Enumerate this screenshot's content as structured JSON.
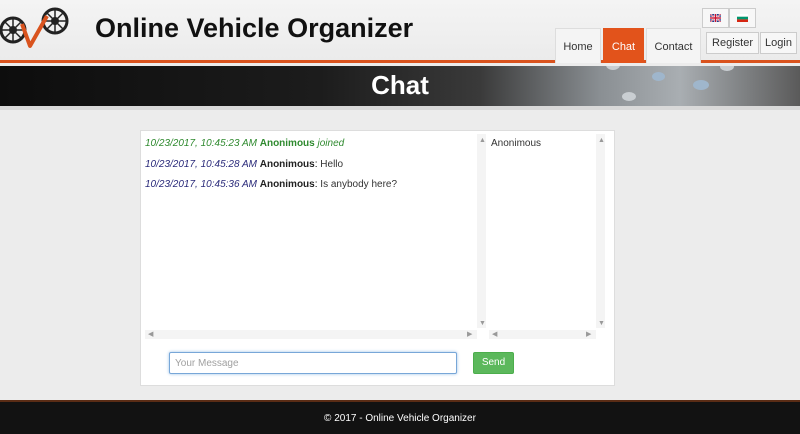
{
  "header": {
    "site_title": "Online Vehicle Organizer",
    "nav": [
      {
        "label": "Home",
        "active": false
      },
      {
        "label": "Chat",
        "active": true
      },
      {
        "label": "Contact",
        "active": false
      }
    ],
    "register_label": "Register",
    "login_label": "Login",
    "language_icons": [
      "english-flag-icon",
      "bulgarian-flag-icon"
    ]
  },
  "banner": {
    "title": "Chat"
  },
  "chat": {
    "messages": [
      {
        "timestamp": "10/23/2017, 10:45:23 AM",
        "user": "Anonimous",
        "text": "joined",
        "type": "join"
      },
      {
        "timestamp": "10/23/2017, 10:45:28 AM",
        "user": "Anonimous",
        "text": "Hello",
        "type": "message"
      },
      {
        "timestamp": "10/23/2017, 10:45:36 AM",
        "user": "Anonimous",
        "text": "Is anybody here?",
        "type": "message"
      }
    ],
    "users": [
      "Anonimous"
    ],
    "input": {
      "placeholder": "Your Message",
      "value": ""
    },
    "send_label": "Send"
  },
  "footer": {
    "text": "© 2017 - Online Vehicle Organizer"
  },
  "colors": {
    "accent": "#e2531b",
    "send_green": "#5cb85c",
    "join_green": "#2f8a2f",
    "timestamp_blue": "#2a2a7a"
  }
}
